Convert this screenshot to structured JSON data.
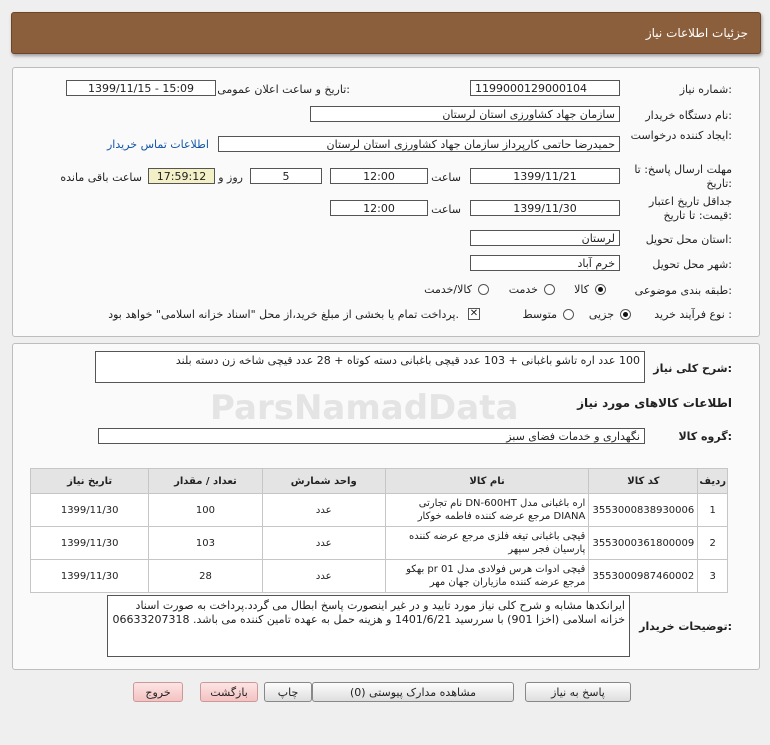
{
  "header": {
    "title": "جزئیات اطلاعات نیاز"
  },
  "form": {
    "need_number_label": "شماره نیاز:",
    "need_number": "1199000129000104",
    "announce_label": "تاریخ و ساعت اعلان عمومی:",
    "announce_value": "1399/11/15 - 15:09",
    "buyer_label": "نام دستگاه خریدار:",
    "buyer_value": "سازمان جهاد کشاورزی استان لرستان",
    "creator_label": "ایجاد کننده درخواست:",
    "creator_value": "حمیدرضا حاتمی کارپرداز سازمان جهاد کشاورزی استان لرستان",
    "contact_link": "اطلاعات تماس خریدار",
    "deadline_label": "مهلت ارسال پاسخ: تا تاریخ:",
    "deadline_date": "1399/11/21",
    "time_label": "ساعت",
    "deadline_time": "12:00",
    "days_value": "5",
    "days_label": "روز و",
    "remaining_time": "17:59:12",
    "remaining_label": "ساعت باقی مانده",
    "validity_label": "جداقل تاریخ اعتبار قیمت: تا تاریخ:",
    "validity_date": "1399/11/30",
    "validity_time": "12:00",
    "province_label": "استان محل تحویل:",
    "province_value": "لرستان",
    "city_label": "شهر محل تحویل:",
    "city_value": "خرم آباد",
    "category_label": "طبقه بندی موضوعی:",
    "category_options": [
      "کالا",
      "خدمت",
      "کالا/خدمت"
    ],
    "category_selected": "کالا",
    "process_label": "نوع فرآیند خرید :",
    "process_options": [
      "جزیی",
      "متوسط"
    ],
    "process_selected": "جزیی",
    "payment_note": "پرداخت تمام یا بخشی از مبلغ خرید،از محل \"اسناد خزانه اسلامی\" خواهد بود."
  },
  "description": {
    "label": "شرح کلی نیاز:",
    "text": "100 عدد اره تاشو باغبانی + 103 عدد قیچی باغبانی دسته کوتاه +  28 عدد قیچی شاخه زن دسته بلند"
  },
  "goods": {
    "section_title": "اطلاعات کالاهای مورد نیاز",
    "group_label": "گروه کالا:",
    "group_value": "نگهداری و خدمات فضای سبز",
    "columns": [
      "ردیف",
      "کد کالا",
      "نام کالا",
      "واحد شمارش",
      "تعداد / مقدار",
      "تاریخ نیاز"
    ],
    "rows": [
      {
        "idx": "1",
        "code": "3553000838930006",
        "name": "اره باغبانی مدل DN-600HT نام تجارتی DIANA مرجع عرضه کننده فاطمه خوکار",
        "unit": "عدد",
        "qty": "100",
        "date": "1399/11/30"
      },
      {
        "idx": "2",
        "code": "3553000361800009",
        "name": "قیچی باغبانی تیغه فلزی مرجع عرضه کننده پارسیان فجر سپهر",
        "unit": "عدد",
        "qty": "103",
        "date": "1399/11/30"
      },
      {
        "idx": "3",
        "code": "3553000987460002",
        "name": "قیچی ادوات هرس فولادی مدل pr 01 بهکو مرجع عرضه کننده مازیاران جهان مهر",
        "unit": "عدد",
        "qty": "28",
        "date": "1399/11/30"
      }
    ]
  },
  "buyer_notes": {
    "label": "توضیحات خریدار:",
    "text": "ایرانکدها مشابه و شرح کلی نیاز مورد تایید و در غیر اینصورت پاسخ ابطال می گردد.پرداخت به صورت اسناد خزانه اسلامی (اخزا 901) با سررسید 1401/6/21 و هزینه حمل به عهده تامین کننده می باشد. 06633207318"
  },
  "buttons": {
    "reply": "پاسخ به نیاز",
    "attachments": "مشاهده مدارک پیوستی (0)",
    "print": "چاپ",
    "back": "بازگشت",
    "exit": "خروج"
  },
  "watermark": {
    "brand": "ParsNamadData"
  },
  "colors": {
    "header": "#8b5e3c",
    "remaining_bg": "#f3efc7",
    "link": "#1155aa"
  }
}
